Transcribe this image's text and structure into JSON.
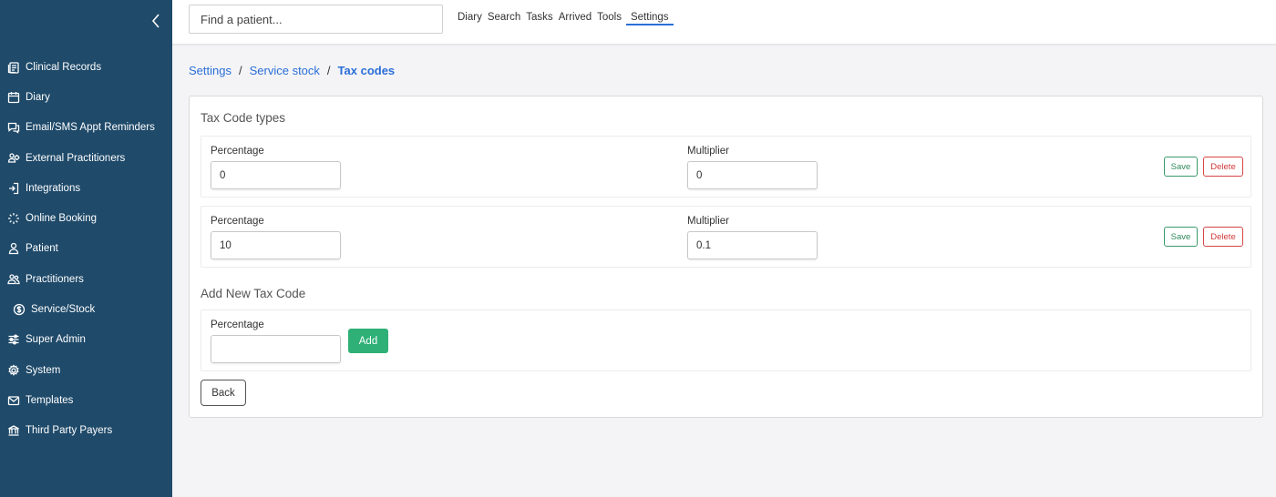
{
  "sidebar": {
    "collapse_icon": "chevron-left-icon",
    "items": [
      {
        "label": "Clinical Records",
        "icon": "clipboard-icon"
      },
      {
        "label": "Diary",
        "icon": "calendar-icon"
      },
      {
        "label": "Email/SMS Appt Reminders",
        "icon": "chat-icon"
      },
      {
        "label": "External Practitioners",
        "icon": "users-gear-icon"
      },
      {
        "label": "Integrations",
        "icon": "sign-in-icon"
      },
      {
        "label": "Online Booking",
        "icon": "sparkle-icon"
      },
      {
        "label": "Patient",
        "icon": "user-icon"
      },
      {
        "label": "Practitioners",
        "icon": "users-icon"
      },
      {
        "label": "Service/Stock",
        "icon": "dollar-circle-icon"
      },
      {
        "label": "Super Admin",
        "icon": "sliders-icon"
      },
      {
        "label": "System",
        "icon": "gear-icon"
      },
      {
        "label": "Templates",
        "icon": "envelope-icon"
      },
      {
        "label": "Third Party Payers",
        "icon": "bank-icon"
      }
    ]
  },
  "topbar": {
    "search_placeholder": "Find a patient...",
    "nav": [
      "Diary",
      "Search",
      "Tasks",
      "Arrived",
      "Tools",
      "Settings"
    ],
    "active": "Settings"
  },
  "breadcrumb": {
    "items": [
      "Settings",
      "Service stock"
    ],
    "current": "Tax codes",
    "separator": "/"
  },
  "tax_codes": {
    "title": "Tax Code types",
    "percentage_label": "Percentage",
    "multiplier_label": "Multiplier",
    "save_label": "Save",
    "delete_label": "Delete",
    "rows": [
      {
        "percentage": "0",
        "multiplier": "0"
      },
      {
        "percentage": "10",
        "multiplier": "0.1"
      }
    ]
  },
  "add_new": {
    "title": "Add New Tax Code",
    "percentage_label": "Percentage",
    "percentage_value": "",
    "add_label": "Add"
  },
  "back_label": "Back",
  "colors": {
    "sidebar_bg": "#1f4a6a",
    "link": "#2a6ed8",
    "save": "#2f8a5c",
    "delete": "#d23a3a",
    "add": "#2eb076"
  }
}
